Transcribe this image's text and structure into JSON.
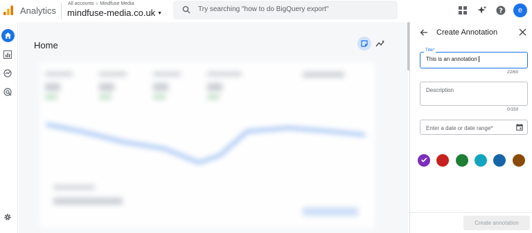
{
  "topbar": {
    "app_name": "Analytics",
    "breadcrumb_account": "All accounts",
    "breadcrumb_property": "Mindfuse Media",
    "property_name": "mindfuse-media.co.uk",
    "search_placeholder": "Try searching \"how to do BigQuery export\"",
    "avatar_letter": "e"
  },
  "main": {
    "title": "Home"
  },
  "panel": {
    "title": "Create Annotation",
    "title_field": {
      "label": "Title*",
      "value": "This is an annotation",
      "counter": "22/60"
    },
    "description_field": {
      "placeholder": "Description",
      "counter": "0/150"
    },
    "date_field": {
      "placeholder": "Enter a date or date range*"
    },
    "colors": [
      "#7b2fbe",
      "#c5221f",
      "#1e7e34",
      "#12a4c0",
      "#1565a8",
      "#8a4b08"
    ],
    "selected_color_index": 0,
    "create_button": "Create annotation"
  }
}
